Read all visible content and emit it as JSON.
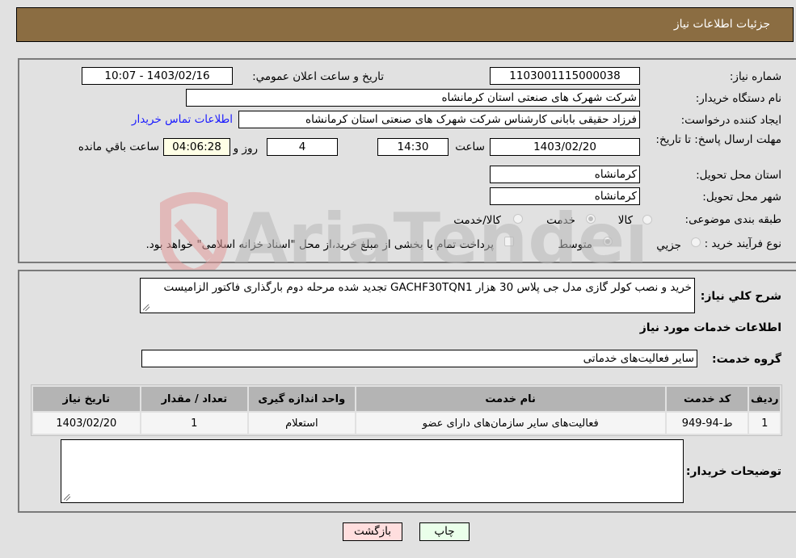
{
  "header": {
    "title": "جزئیات اطلاعات نیاز"
  },
  "details": {
    "need_number_label": "شماره نیاز:",
    "need_number": "1103001115000038",
    "announce_label": "تاریخ و ساعت اعلان عمومي:",
    "announce_value": "1403/02/16 - 10:07",
    "buyer_org_label": "نام دستگاه خریدار:",
    "buyer_org": "شرکت شهرک های صنعتی استان کرمانشاه",
    "creator_label": "ایجاد کننده درخواست:",
    "creator": "فرزاد حقیقی بابانی کارشناس شرکت شهرک های صنعتی استان کرمانشاه",
    "contact_link": "اطلاعات تماس خریدار",
    "deadline_label": "مهلت ارسال پاسخ: تا تاریخ:",
    "deadline_date": "1403/02/20",
    "time_label": "ساعت",
    "deadline_time": "14:30",
    "days_value": "4",
    "days_label": "روز و",
    "remaining_time": "04:06:28",
    "remaining_label": "ساعت باقي مانده",
    "province_label": "استان محل تحویل:",
    "province": "کرمانشاه",
    "city_label": "شهر محل تحویل:",
    "city": "کرمانشاه",
    "category_label": "طبقه بندی موضوعی:",
    "category_options": [
      "کالا",
      "خدمت",
      "کالا/خدمت"
    ],
    "category_selected": "خدمت",
    "process_label": "نوع فرآیند خرید :",
    "process_options": [
      "جزيي",
      "متوسط"
    ],
    "process_selected": "متوسط",
    "treasury_note": "پرداخت تمام یا بخشی از مبلغ خرید،از محل \"اسناد خزانه اسلامی\" خواهد بود."
  },
  "services": {
    "description_label": "شرح کلي نیاز:",
    "description": "خرید و نصب کولر گازی مدل جی پلاس 30 هزار GACHF30TQN1 تجدید شده مرحله دوم بارگذاری فاکتور الزامیست",
    "section_title": "اطلاعات خدمات مورد نیاز",
    "group_label": "گروه خدمت:",
    "group_value": "سایر فعالیت‌های خدماتی",
    "table": {
      "headers": [
        "ردیف",
        "کد خدمت",
        "نام خدمت",
        "واحد اندازه گیری",
        "تعداد / مقدار",
        "تاریخ نیاز"
      ],
      "rows": [
        [
          "1",
          "ط-94-949",
          "فعالیت‌های سایر سازمان‌های دارای عضو",
          "استعلام",
          "1",
          "1403/02/20"
        ]
      ]
    },
    "buyer_notes_label": "توضیحات خریدار:",
    "buyer_notes": ""
  },
  "buttons": {
    "print": "چاپ",
    "back": "بازگشت"
  },
  "watermark": {
    "text": "AriaTender.net"
  }
}
